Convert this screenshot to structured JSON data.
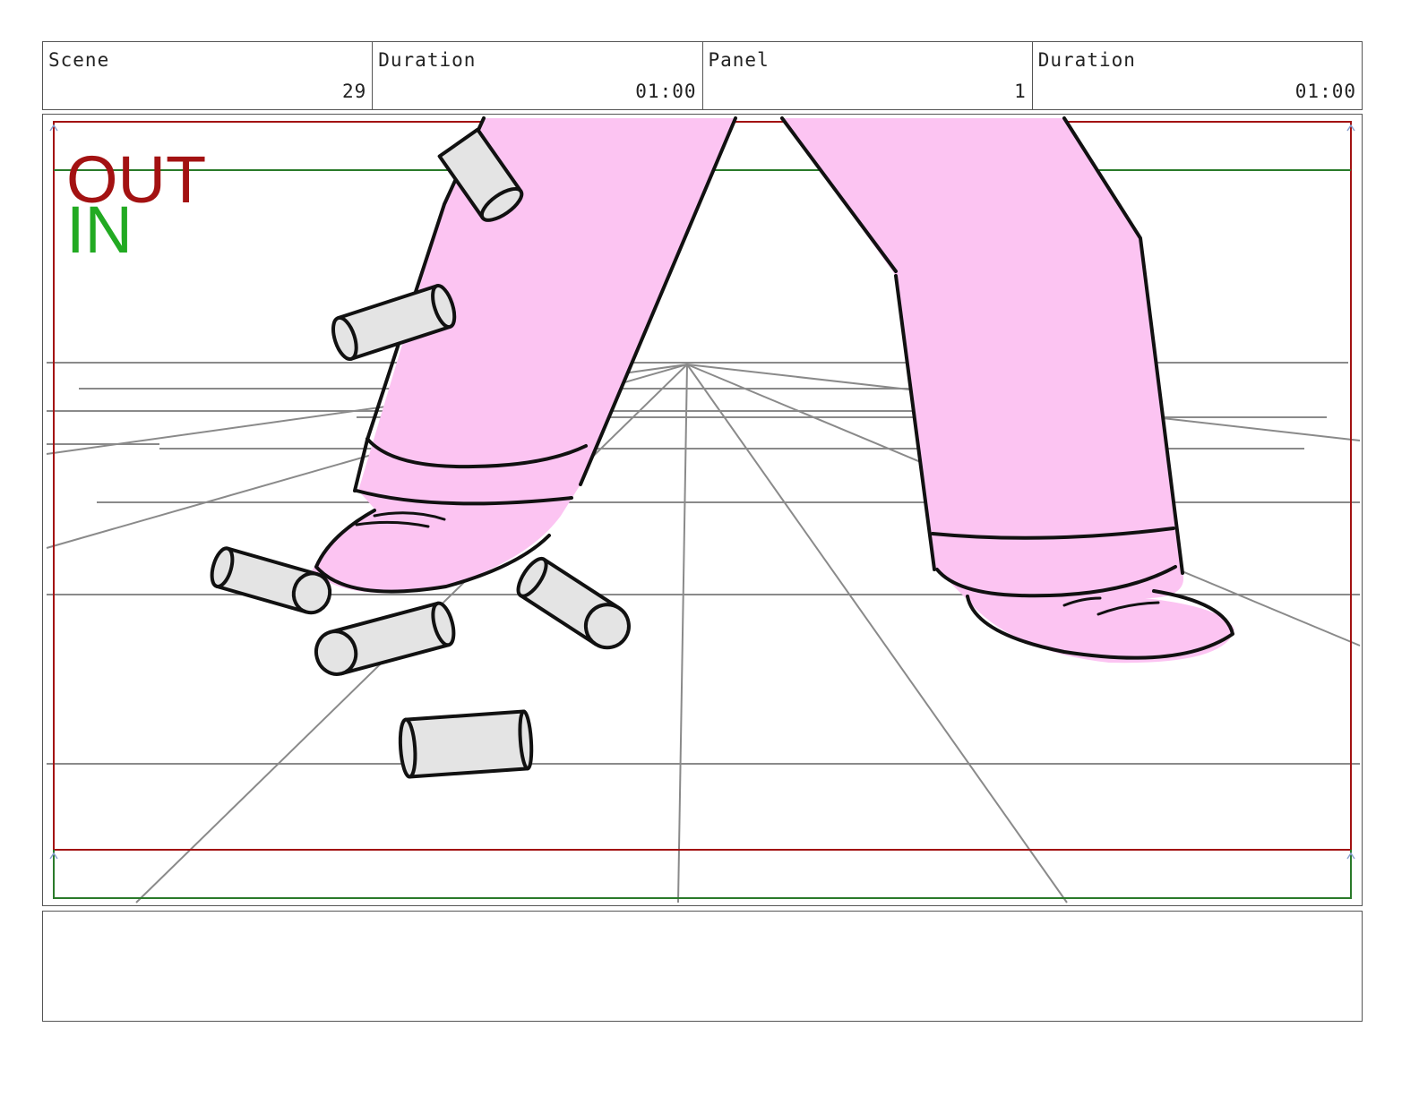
{
  "header": {
    "scene_label": "Scene",
    "scene_value": "29",
    "scene_duration_label": "Duration",
    "scene_duration_value": "01:00",
    "panel_label": "Panel",
    "panel_value": "1",
    "panel_duration_label": "Duration",
    "panel_duration_value": "01:00"
  },
  "frame": {
    "out_label": "OUT",
    "in_label": "IN",
    "out_color": "#a31212",
    "in_color": "#22aa22",
    "pants_color": "#fcc4f2",
    "can_color": "#e4e4e4"
  },
  "notes": {
    "text": ""
  }
}
